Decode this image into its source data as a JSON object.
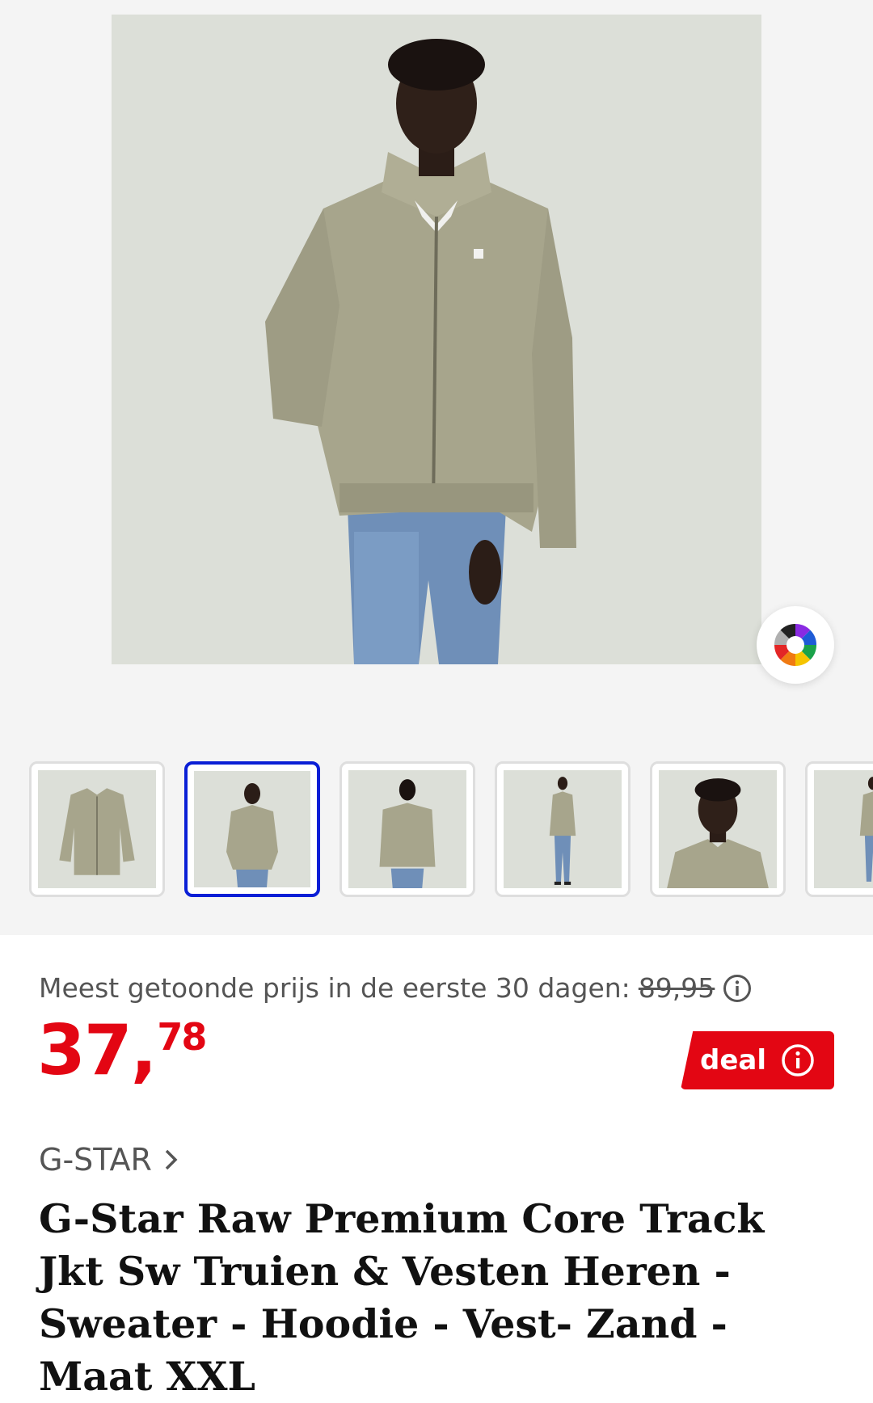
{
  "gallery": {
    "main_image_alt": "",
    "thumbnails": [
      {
        "kind": "flat-jacket",
        "active": false
      },
      {
        "kind": "model-front",
        "active": true
      },
      {
        "kind": "model-back",
        "active": false
      },
      {
        "kind": "model-full",
        "active": false
      },
      {
        "kind": "model-closeup",
        "active": false
      },
      {
        "kind": "model-partial",
        "active": false
      }
    ],
    "color_wheel_icon": "color-wheel-icon",
    "active_border_color": "#0a1fd6"
  },
  "pricing": {
    "note": "Meest getoonde prijs in de eerste 30 dagen:",
    "old_price": "89,95",
    "price_euros": "37",
    "price_separator": ",",
    "price_cents": "78",
    "price_color": "#e30613",
    "deal_label": "deal"
  },
  "product": {
    "brand": "G-STAR",
    "title": "G-Star Raw Premium Core Track Jkt Sw Truien & Vesten Heren - Sweater - Hoodie - Vest- Zand - Maat XXL"
  }
}
